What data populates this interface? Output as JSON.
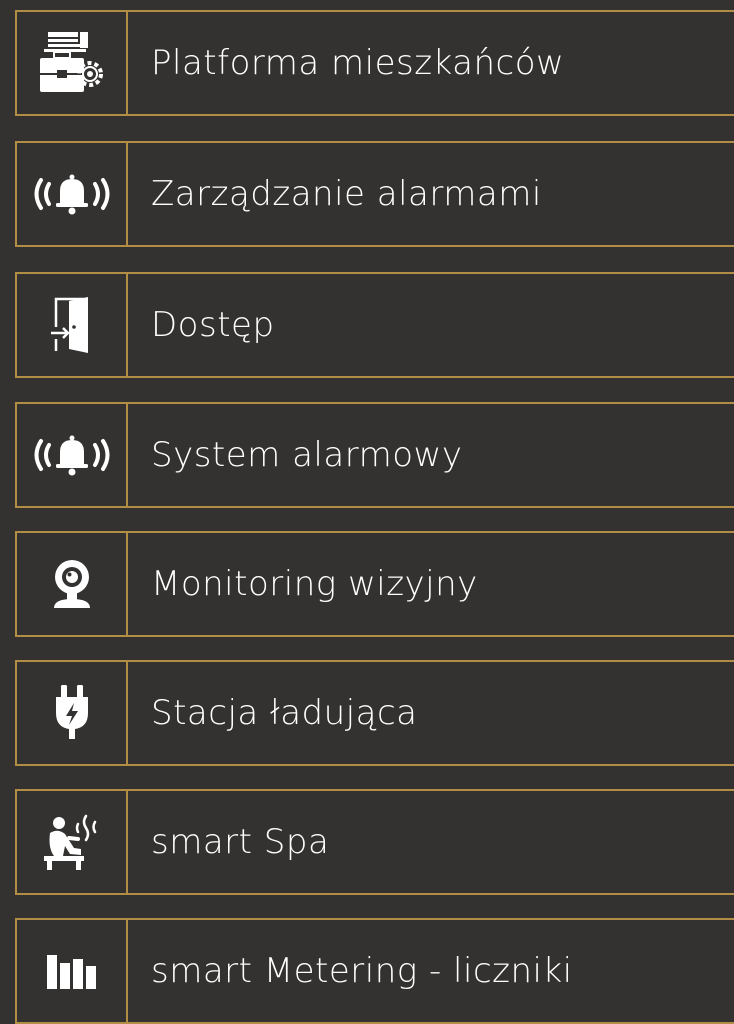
{
  "colors": {
    "background": "#333230",
    "border": "#b18e44",
    "text": "#ffffff",
    "icon": "#ffffff"
  },
  "menu": {
    "items": [
      {
        "label": "Platforma mieszkańców",
        "icon": "briefcase-documents-gear-icon"
      },
      {
        "label": "Zarządzanie alarmami",
        "icon": "alarm-bell-icon"
      },
      {
        "label": "Dostęp",
        "icon": "door-enter-icon"
      },
      {
        "label": "System alarmowy",
        "icon": "alarm-bell-icon"
      },
      {
        "label": "Monitoring wizyjny",
        "icon": "webcam-icon"
      },
      {
        "label": "Stacja ładująca",
        "icon": "charging-plug-icon"
      },
      {
        "label": "smart Spa",
        "icon": "sauna-person-icon"
      },
      {
        "label": "smart Metering - liczniki",
        "icon": "meter-bars-icon"
      }
    ]
  }
}
